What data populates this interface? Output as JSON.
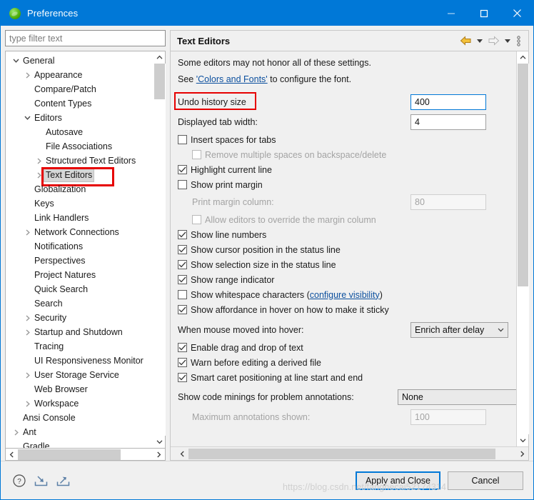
{
  "window": {
    "title": "Preferences",
    "icon": "eclipse-icon",
    "controls": {
      "minimize": "minimize-icon",
      "maximize": "maximize-icon",
      "close": "close-icon"
    }
  },
  "sidebar": {
    "filter": {
      "value": "",
      "placeholder": "type filter text"
    },
    "items": [
      {
        "label": "General",
        "indent": 0,
        "twisty": "down",
        "selected": false
      },
      {
        "label": "Appearance",
        "indent": 1,
        "twisty": "right",
        "selected": false
      },
      {
        "label": "Compare/Patch",
        "indent": 1,
        "twisty": "none",
        "selected": false
      },
      {
        "label": "Content Types",
        "indent": 1,
        "twisty": "none",
        "selected": false
      },
      {
        "label": "Editors",
        "indent": 1,
        "twisty": "down",
        "selected": false
      },
      {
        "label": "Autosave",
        "indent": 2,
        "twisty": "none",
        "selected": false
      },
      {
        "label": "File Associations",
        "indent": 2,
        "twisty": "none",
        "selected": false
      },
      {
        "label": "Structured Text Editors",
        "indent": 2,
        "twisty": "right",
        "selected": false
      },
      {
        "label": "Text Editors",
        "indent": 2,
        "twisty": "right",
        "selected": true,
        "annotated": true
      },
      {
        "label": "Globalization",
        "indent": 1,
        "twisty": "none",
        "selected": false
      },
      {
        "label": "Keys",
        "indent": 1,
        "twisty": "none",
        "selected": false
      },
      {
        "label": "Link Handlers",
        "indent": 1,
        "twisty": "none",
        "selected": false
      },
      {
        "label": "Network Connections",
        "indent": 1,
        "twisty": "right",
        "selected": false
      },
      {
        "label": "Notifications",
        "indent": 1,
        "twisty": "none",
        "selected": false
      },
      {
        "label": "Perspectives",
        "indent": 1,
        "twisty": "none",
        "selected": false
      },
      {
        "label": "Project Natures",
        "indent": 1,
        "twisty": "none",
        "selected": false
      },
      {
        "label": "Quick Search",
        "indent": 1,
        "twisty": "none",
        "selected": false
      },
      {
        "label": "Search",
        "indent": 1,
        "twisty": "none",
        "selected": false
      },
      {
        "label": "Security",
        "indent": 1,
        "twisty": "right",
        "selected": false
      },
      {
        "label": "Startup and Shutdown",
        "indent": 1,
        "twisty": "right",
        "selected": false
      },
      {
        "label": "Tracing",
        "indent": 1,
        "twisty": "none",
        "selected": false
      },
      {
        "label": "UI Responsiveness Monitor",
        "indent": 1,
        "twisty": "none",
        "selected": false
      },
      {
        "label": "User Storage Service",
        "indent": 1,
        "twisty": "right",
        "selected": false
      },
      {
        "label": "Web Browser",
        "indent": 1,
        "twisty": "none",
        "selected": false
      },
      {
        "label": "Workspace",
        "indent": 1,
        "twisty": "right",
        "selected": false
      },
      {
        "label": "Ansi Console",
        "indent": 0,
        "twisty": "none",
        "selected": false
      },
      {
        "label": "Ant",
        "indent": 0,
        "twisty": "right",
        "selected": false
      },
      {
        "label": "Gradle",
        "indent": 0,
        "twisty": "none",
        "selected": false
      }
    ]
  },
  "page": {
    "title": "Text Editors",
    "toolbar": {
      "back": "back-arrow-icon",
      "back_menu": "chevron-down-icon",
      "forward": "forward-arrow-icon",
      "forward_menu": "chevron-down-icon",
      "view_menu": "vertical-dots-icon"
    },
    "intro_line": "Some editors may not honor all of these settings.",
    "font_line_prefix": "See ",
    "font_link": "'Colors and Fonts'",
    "font_line_suffix": " to configure the font.",
    "undo_history": {
      "label": "Undo history size",
      "value": "400",
      "annotated": true
    },
    "tab_width": {
      "label": "Displayed tab width:",
      "value": "4"
    },
    "checkboxes": [
      {
        "label": "Insert spaces for tabs",
        "checked": false,
        "disabled": false,
        "indent": false
      },
      {
        "label": "Remove multiple spaces on backspace/delete",
        "checked": false,
        "disabled": true,
        "indent": true
      },
      {
        "label": "Highlight current line",
        "checked": true,
        "disabled": false,
        "indent": false
      },
      {
        "label": "Show print margin",
        "checked": false,
        "disabled": false,
        "indent": false
      }
    ],
    "print_margin": {
      "label": "Print margin column:",
      "value": "80",
      "disabled": true
    },
    "override_margin": {
      "label": "Allow editors to override the margin column",
      "checked": false,
      "disabled": true
    },
    "checkboxes2": [
      {
        "label": "Show line numbers",
        "checked": true
      },
      {
        "label": "Show cursor position in the status line",
        "checked": true
      },
      {
        "label": "Show selection size in the status line",
        "checked": true
      },
      {
        "label": "Show range indicator",
        "checked": true
      }
    ],
    "whitespace": {
      "label": "Show whitespace characters",
      "link": "configure visibility",
      "checked": false
    },
    "sticky_hover": {
      "label": "Show affordance in hover on how to make it sticky",
      "checked": true
    },
    "hover_behavior": {
      "label": "When mouse moved into hover:",
      "value": "Enrich after delay"
    },
    "checkboxes3": [
      {
        "label": "Enable drag and drop of text",
        "checked": true
      },
      {
        "label": "Warn before editing a derived file",
        "checked": true
      },
      {
        "label": "Smart caret positioning at line start and end",
        "checked": true
      }
    ],
    "code_minings": {
      "label": "Show code minings for problem annotations:",
      "value": "None"
    },
    "max_annotations": {
      "label": "Maximum annotations shown:",
      "value": "100",
      "disabled": true
    }
  },
  "footer": {
    "help_icon": "help-icon",
    "import_icon": "import-icon",
    "export_icon": "export-icon",
    "apply_label": "Apply and Close",
    "cancel_label": "Cancel"
  },
  "watermark": "https://blog.csdn.net/fanghecai52174314"
}
